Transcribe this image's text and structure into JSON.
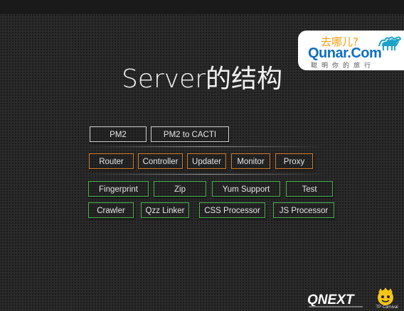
{
  "title": "Server的结构",
  "brand": {
    "cn": "去哪儿?",
    "en": "Qunar.Com",
    "sub": "聪明你的旅行"
  },
  "rows": {
    "pm": [
      "PM2",
      "PM2 to CACTI"
    ],
    "core": [
      "Router",
      "Controller",
      "Updater",
      "Monitor",
      "Proxy"
    ],
    "plugins1": [
      "Fingerprint",
      "Zip",
      "Yum Support",
      "Test"
    ],
    "plugins2": [
      "Crawler",
      "Qzz Linker",
      "CSS Processor",
      "JS Processor"
    ]
  },
  "footer": {
    "qnext": "QNEXT",
    "tp": "TP Carnival"
  },
  "colors": {
    "pm_border": "#cfcfcf",
    "core_border": "#d37a2a",
    "plugin_border": "#49b14c",
    "brand_blue": "#0e6ec1",
    "brand_orange": "#f39c12"
  }
}
